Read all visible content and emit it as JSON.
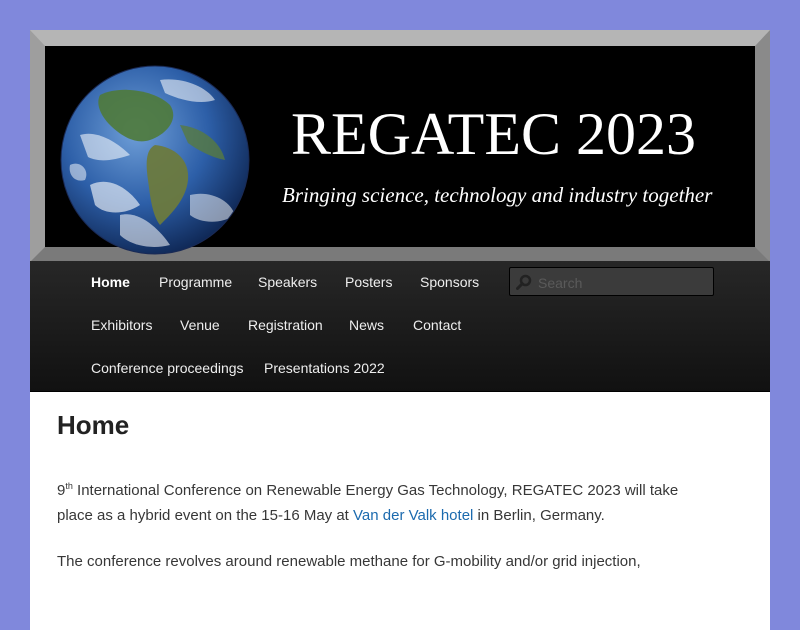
{
  "header": {
    "title": "REGATEC 2023",
    "tagline": "Bringing science, technology and industry together"
  },
  "nav": {
    "items": [
      {
        "label": "Home",
        "active": true
      },
      {
        "label": "Programme"
      },
      {
        "label": "Speakers"
      },
      {
        "label": "Posters"
      },
      {
        "label": "Sponsors"
      },
      {
        "label": "Exhibitors"
      },
      {
        "label": "Venue"
      },
      {
        "label": "Registration"
      },
      {
        "label": "News"
      },
      {
        "label": "Contact"
      },
      {
        "label": "Conference proceedings"
      },
      {
        "label": "Presentations 2022"
      }
    ],
    "search_placeholder": "Search"
  },
  "main": {
    "page_title": "Home",
    "intro": {
      "ordinal": "9",
      "ordinal_suffix": "th",
      "text_before_link": " International Conference on Renewable Energy Gas Technology, REGATEC 2023 will take place as a hybrid event on the 15-16 May at ",
      "link_text": "Van der Valk hotel",
      "text_after_link": " in Berlin, Germany."
    },
    "paragraph2": "The conference revolves around renewable methane for G-mobility and/or grid injection,"
  },
  "colors": {
    "background": "#8088dc",
    "link": "#1b6aae",
    "nav_bg": "#1c1c1c"
  }
}
